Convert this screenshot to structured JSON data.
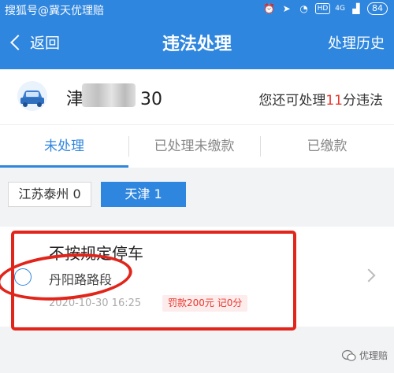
{
  "statusbar": {
    "watermark": "搜狐号@冀天优理赔",
    "hd": "HD",
    "network": "4G",
    "battery": "84"
  },
  "nav": {
    "back_label": "返回",
    "title": "违法处理",
    "history_label": "处理历史"
  },
  "vehicle": {
    "plate_prefix": "津",
    "plate_suffix": "30",
    "remain_prefix": "您还可处理",
    "remain_points": "11",
    "remain_suffix": "分违法"
  },
  "tabs": [
    {
      "label": "未处理"
    },
    {
      "label": "已处理未缴款"
    },
    {
      "label": "已缴款"
    }
  ],
  "regions": [
    {
      "label": "江苏泰州 0"
    },
    {
      "label": "天津 1"
    }
  ],
  "violation": {
    "title": "不按规定停车",
    "location": "丹阳路路段",
    "datetime": "2020-10-30 16:25",
    "fine": "罚款200元 记0分"
  },
  "bottom_watermark": "优理赔",
  "colors": {
    "primary": "#2f86de",
    "accent_red": "#e8372d",
    "annotation_red": "#e1251b"
  }
}
